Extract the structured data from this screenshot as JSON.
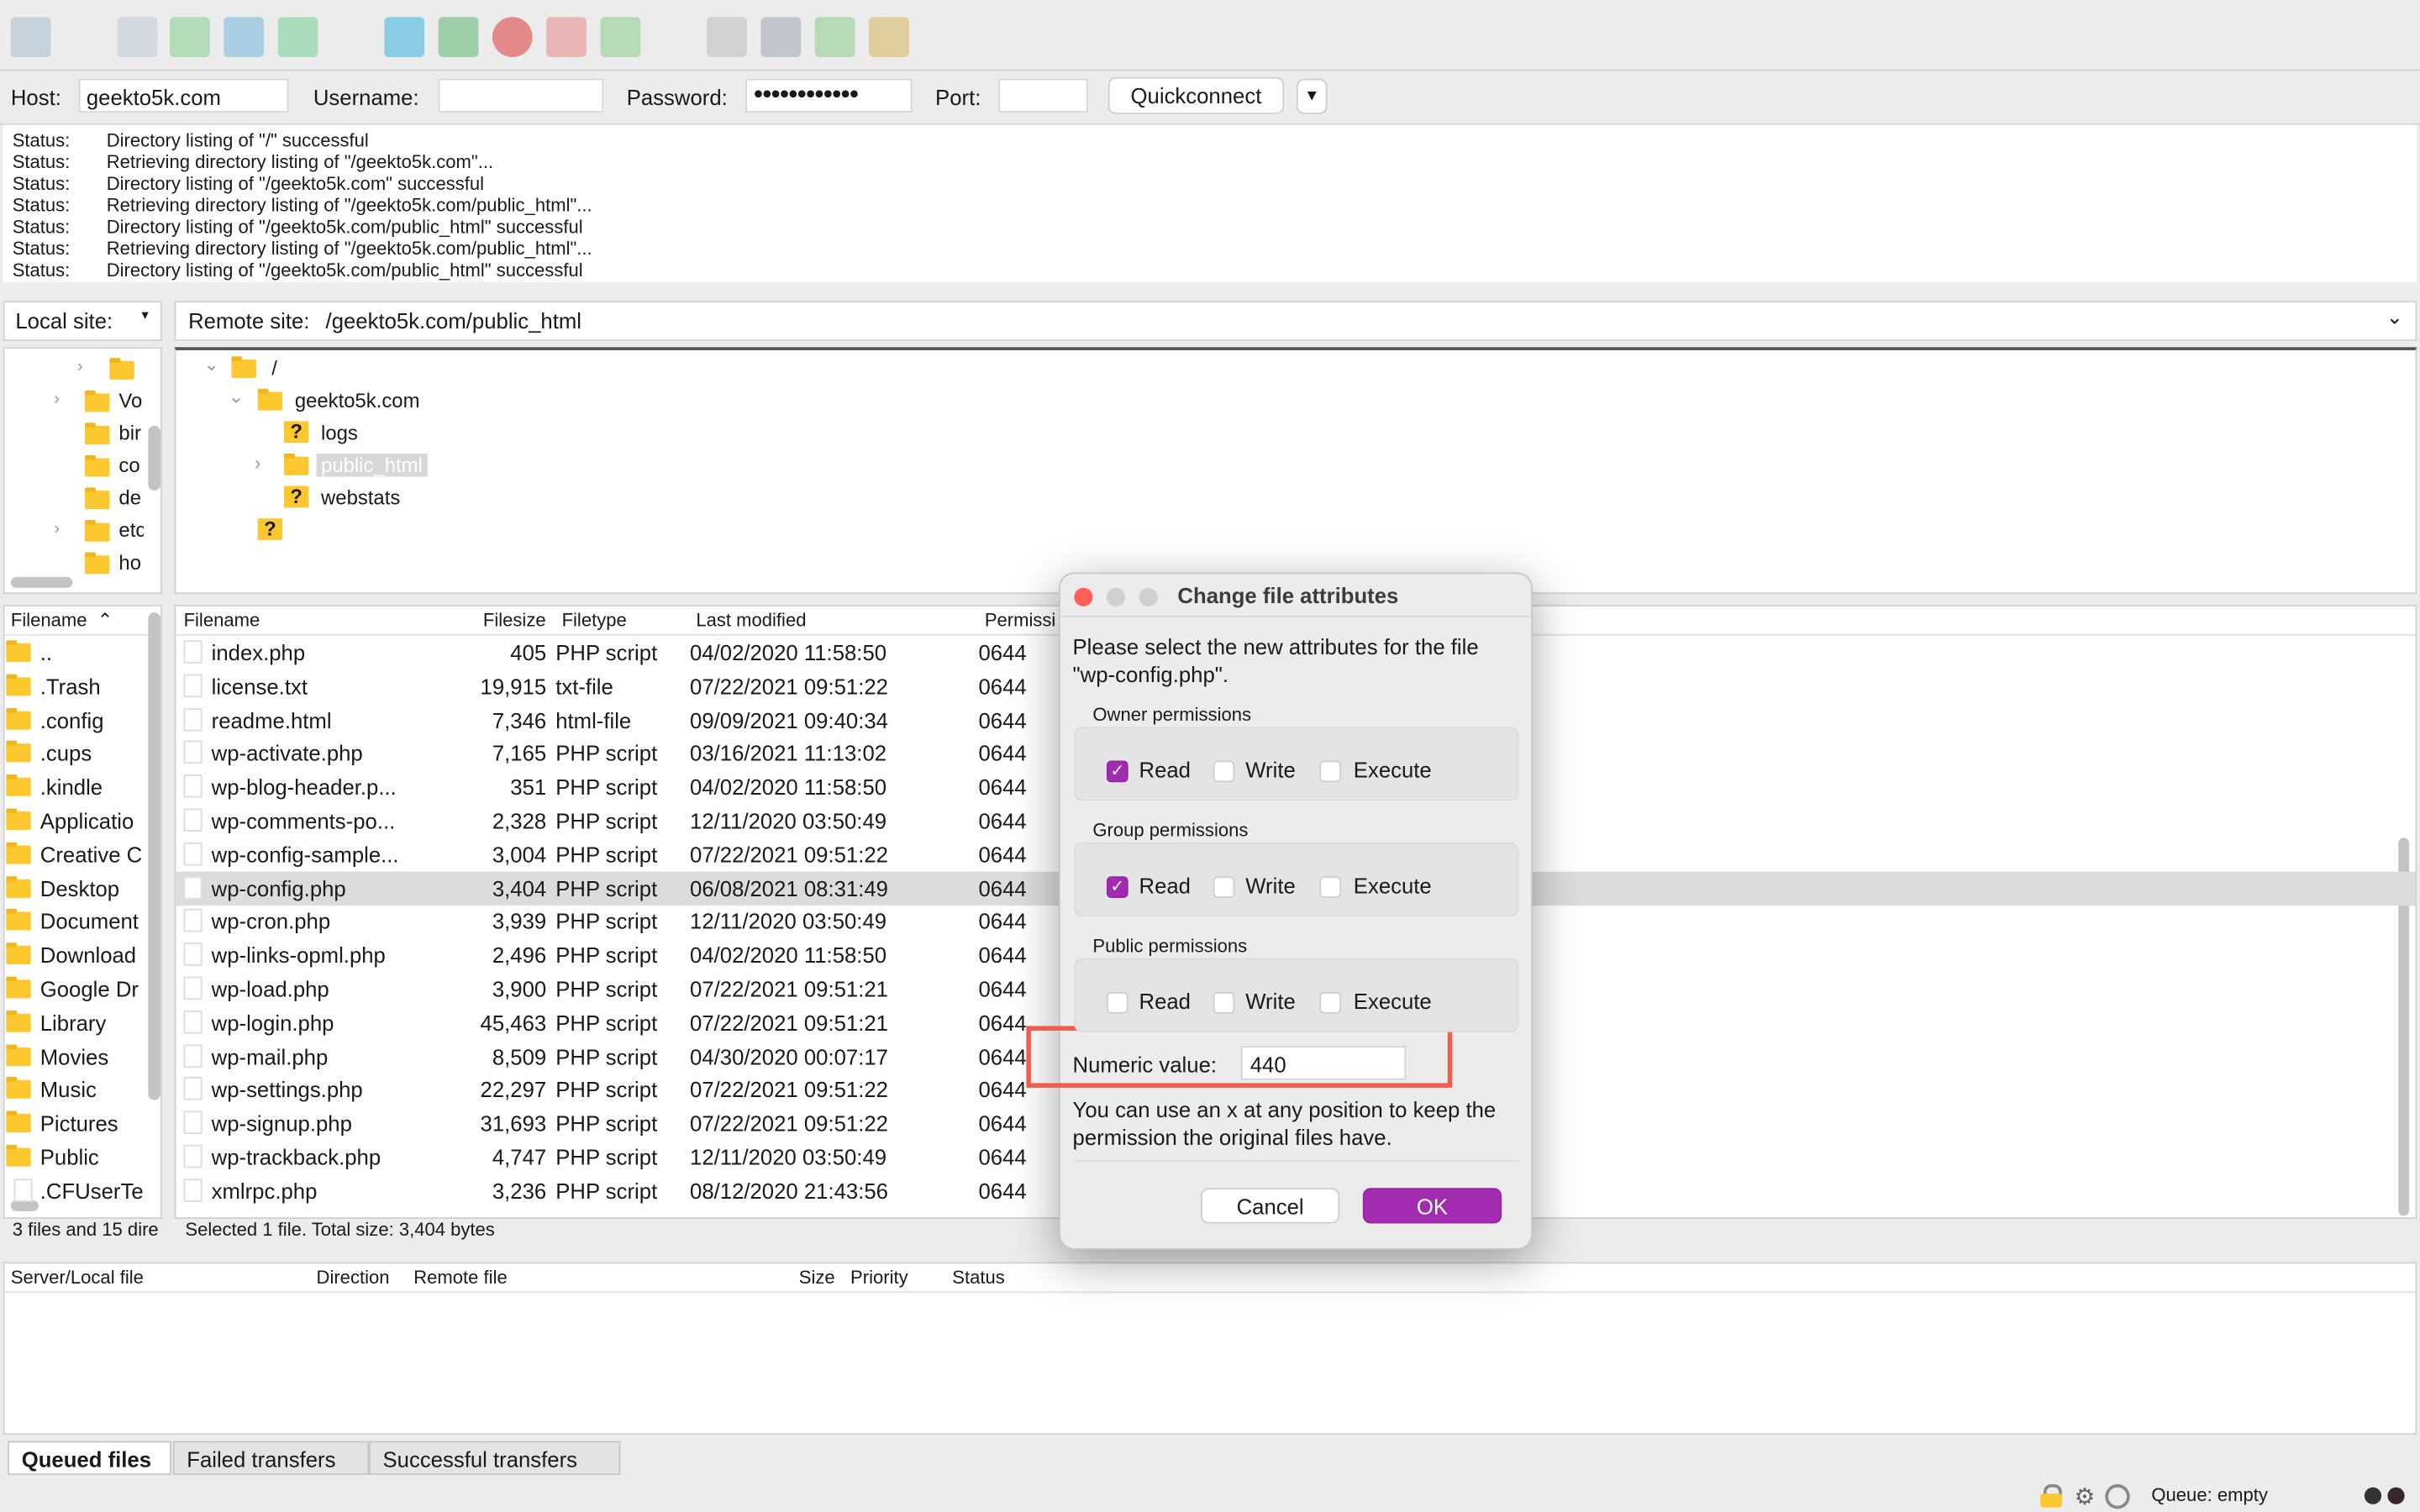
{
  "toolbar": {
    "icons": [
      "site-manager-icon",
      "message-log-icon",
      "local-tree-icon",
      "remote-tree-icon",
      "transfer-queue-icon",
      "refresh-icon",
      "process-queue-icon",
      "cancel-icon",
      "disconnect-icon",
      "reconnect-icon",
      "directory-filters-icon",
      "compare-icon",
      "sync-browse-icon",
      "find-files-icon"
    ]
  },
  "quickconnect": {
    "host_label": "Host:",
    "host_value": "geekto5k.com",
    "username_label": "Username:",
    "username_value": "",
    "password_label": "Password:",
    "password_value": "●●●●●●●●●●●●",
    "port_label": "Port:",
    "port_value": "",
    "button": "Quickconnect"
  },
  "log": [
    {
      "k": "Status:",
      "v": "Directory listing of \"/\" successful"
    },
    {
      "k": "Status:",
      "v": "Retrieving directory listing of \"/geekto5k.com\"..."
    },
    {
      "k": "Status:",
      "v": "Directory listing of \"/geekto5k.com\" successful"
    },
    {
      "k": "Status:",
      "v": "Retrieving directory listing of \"/geekto5k.com/public_html\"..."
    },
    {
      "k": "Status:",
      "v": "Directory listing of \"/geekto5k.com/public_html\" successful"
    },
    {
      "k": "Status:",
      "v": "Retrieving directory listing of \"/geekto5k.com/public_html\"..."
    },
    {
      "k": "Status:",
      "v": "Directory listing of \"/geekto5k.com/public_html\" successful"
    }
  ],
  "local": {
    "label": "Local site:",
    "tree": [
      "",
      "Vo",
      "bir",
      "co",
      "de",
      "etc",
      "ho"
    ],
    "header": "Filename",
    "files": [
      "..",
      ".Trash",
      ".config",
      ".cups",
      ".kindle",
      "Applicatio",
      "Creative C",
      "Desktop",
      "Document",
      "Download",
      "Google Dr",
      "Library",
      "Movies",
      "Music",
      "Pictures",
      "Public",
      ".CFUserTe"
    ],
    "status": "3 files and 15 dire"
  },
  "remote": {
    "label": "Remote site:",
    "path": "/geekto5k.com/public_html",
    "tree": [
      {
        "name": "/"
      },
      {
        "name": "geekto5k.com"
      },
      {
        "name": "logs"
      },
      {
        "name": "public_html"
      },
      {
        "name": "webstats"
      },
      {
        "name": ""
      }
    ],
    "headers": {
      "name": "Filename",
      "size": "Filesize",
      "type": "Filetype",
      "modified": "Last modified",
      "perm": "Permissi"
    },
    "files": [
      [
        "index.php",
        "405",
        "PHP script",
        "04/02/2020 11:58:50",
        "0644"
      ],
      [
        "license.txt",
        "19,915",
        "txt-file",
        "07/22/2021 09:51:22",
        "0644"
      ],
      [
        "readme.html",
        "7,346",
        "html-file",
        "09/09/2021 09:40:34",
        "0644"
      ],
      [
        "wp-activate.php",
        "7,165",
        "PHP script",
        "03/16/2021 11:13:02",
        "0644"
      ],
      [
        "wp-blog-header.p...",
        "351",
        "PHP script",
        "04/02/2020 11:58:50",
        "0644"
      ],
      [
        "wp-comments-po...",
        "2,328",
        "PHP script",
        "12/11/2020 03:50:49",
        "0644"
      ],
      [
        "wp-config-sample...",
        "3,004",
        "PHP script",
        "07/22/2021 09:51:22",
        "0644"
      ],
      [
        "wp-config.php",
        "3,404",
        "PHP script",
        "06/08/2021 08:31:49",
        "0644"
      ],
      [
        "wp-cron.php",
        "3,939",
        "PHP script",
        "12/11/2020 03:50:49",
        "0644"
      ],
      [
        "wp-links-opml.php",
        "2,496",
        "PHP script",
        "04/02/2020 11:58:50",
        "0644"
      ],
      [
        "wp-load.php",
        "3,900",
        "PHP script",
        "07/22/2021 09:51:21",
        "0644"
      ],
      [
        "wp-login.php",
        "45,463",
        "PHP script",
        "07/22/2021 09:51:21",
        "0644"
      ],
      [
        "wp-mail.php",
        "8,509",
        "PHP script",
        "04/30/2020 00:07:17",
        "0644"
      ],
      [
        "wp-settings.php",
        "22,297",
        "PHP script",
        "07/22/2021 09:51:22",
        "0644"
      ],
      [
        "wp-signup.php",
        "31,693",
        "PHP script",
        "07/22/2021 09:51:22",
        "0644"
      ],
      [
        "wp-trackback.php",
        "4,747",
        "PHP script",
        "12/11/2020 03:50:49",
        "0644"
      ],
      [
        "xmlrpc.php",
        "3,236",
        "PHP script",
        "08/12/2020 21:43:56",
        "0644"
      ]
    ],
    "selected_index": 7,
    "status": "Selected 1 file. Total size: 3,404 bytes"
  },
  "queue": {
    "headers": [
      "Server/Local file",
      "Direction",
      "Remote file",
      "Size",
      "Priority",
      "Status"
    ],
    "tabs": [
      "Queued files",
      "Failed transfers",
      "Successful transfers"
    ],
    "status": "Queue: empty"
  },
  "dialog": {
    "title": "Change file attributes",
    "intro": "Please select the new attributes for the file \"wp-config.php\".",
    "groups": [
      {
        "label": "Owner permissions",
        "read": true,
        "write": false,
        "execute": false
      },
      {
        "label": "Group permissions",
        "read": true,
        "write": false,
        "execute": false
      },
      {
        "label": "Public permissions",
        "read": false,
        "write": false,
        "execute": false
      }
    ],
    "read_label": "Read",
    "write_label": "Write",
    "execute_label": "Execute",
    "numeric_label": "Numeric value:",
    "numeric_value": "440",
    "hint": "You can use an x at any position to keep the permission the original files have.",
    "cancel": "Cancel",
    "ok": "OK"
  },
  "colors": {
    "accent": "#a12cb0",
    "highlight": "#f25c4c",
    "folder": "#fdc82f"
  }
}
